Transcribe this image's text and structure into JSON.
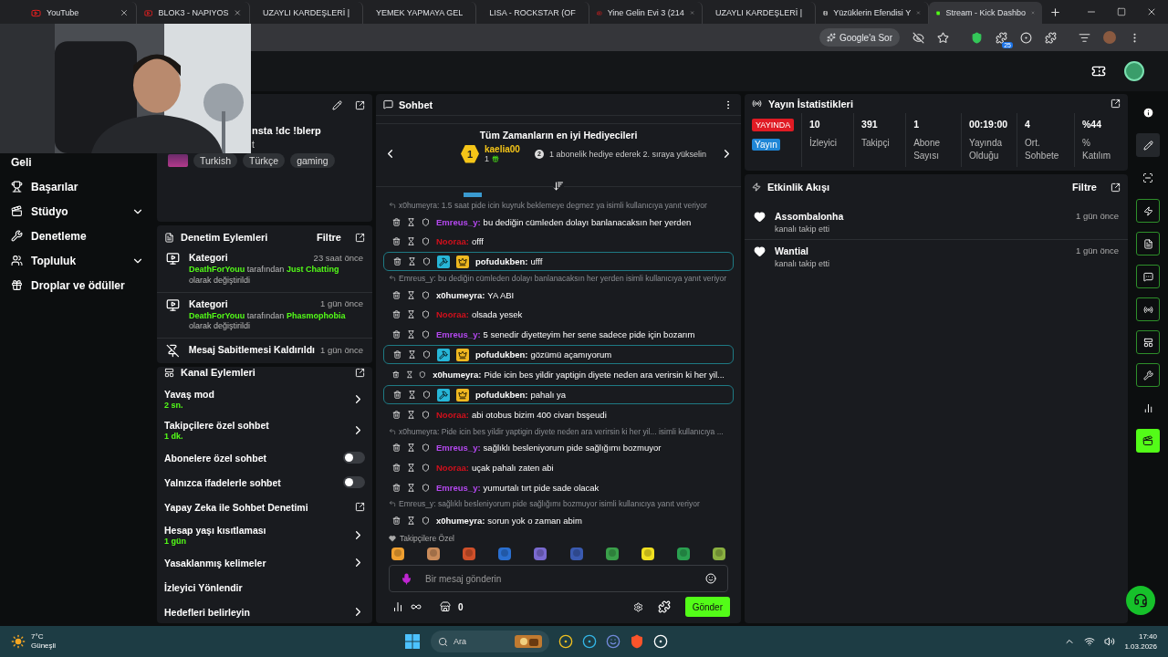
{
  "browser": {
    "tabs": [
      {
        "title": "YouTube",
        "selected": false
      },
      {
        "title": "BLOK3 - NAPIYOS",
        "selected": false
      },
      {
        "title": "UZAYLI KARDEŞLERİ |",
        "selected": false
      },
      {
        "title": "YEMEK YAPMAYA GEL",
        "selected": false
      },
      {
        "title": "LISA - ROCKSTAR (OF",
        "selected": false
      },
      {
        "title": "Yine Gelin Evi 3 (214",
        "selected": false
      },
      {
        "title": "UZAYLI KARDEŞLERİ |",
        "selected": false
      },
      {
        "title": "Yüzüklerin Efendisi Y",
        "selected": false
      },
      {
        "title": "Stream - Kick Dashbo",
        "selected": true
      }
    ],
    "ask_button": "Google'a Sor",
    "extension_badge": "25"
  },
  "sidebar": {
    "items": [
      {
        "label": "Geli",
        "expandable": false
      },
      {
        "label": "Başarılar",
        "expandable": false
      },
      {
        "label": "Stüdyo",
        "expandable": true
      },
      {
        "label": "Denetleme",
        "expandable": false
      },
      {
        "label": "Topluluk",
        "expandable": true
      },
      {
        "label": "Droplar ve ödüller",
        "expandable": false
      }
    ]
  },
  "stream_info": {
    "title": "nsta !dc !blerp",
    "subtitle": "t",
    "tags": [
      "Turkish",
      "Türkçe",
      "gaming"
    ]
  },
  "moderation": {
    "title": "Denetim Eylemleri",
    "filter": "Filtre",
    "items": [
      {
        "kind": "category",
        "title": "Kategori",
        "time": "23 saat önce",
        "detail": "**DeathForYouu** tarafından **Just Chatting** olarak değiştirildi"
      },
      {
        "kind": "category",
        "title": "Kategori",
        "time": "1 gün önce",
        "detail": "**DeathForYouu** tarafından **Phasmophobia** olarak değiştirildi"
      },
      {
        "kind": "unpin",
        "title": "Mesaj Sabitlemesi Kaldırıldı",
        "time": "1 gün önce"
      }
    ]
  },
  "channel_actions": {
    "title": "Kanal Eylemleri",
    "items": [
      {
        "kind": "chevron",
        "label": "Yavaş mod",
        "value": "2 sn."
      },
      {
        "kind": "chevron",
        "label": "Takipçilere özel sohbet",
        "value": "1 dk."
      },
      {
        "kind": "toggle",
        "label": "Abonelere özel sohbet",
        "on": false
      },
      {
        "kind": "toggle",
        "label": "Yalnızca ifadelerle sohbet",
        "on": false
      },
      {
        "kind": "link",
        "label": "Yapay Zeka ile Sohbet Denetimi"
      },
      {
        "kind": "chevron",
        "label": "Hesap yaşı kısıtlaması",
        "value": "1 gün"
      },
      {
        "kind": "chevron",
        "label": "Yasaklanmış kelimeler"
      },
      {
        "kind": "plain",
        "label": "İzleyici Yönlendir"
      },
      {
        "kind": "chevron",
        "label": "Hedefleri belirleyin"
      }
    ]
  },
  "chat": {
    "title": "Sohbet",
    "gifters": {
      "title": "Tüm Zamanların en iyi Hediyecileri",
      "rank": "1",
      "name": "kaelia00",
      "count": "1",
      "hint_rank": "2",
      "hint": "1 abonelik hediye ederek 2. sıraya yükselin"
    },
    "messages": [
      {
        "kind": "reply",
        "text": "x0humeyra: 1.5 saat pide icin kuyruk beklemeye degmez ya isimli kullanıcıya yanıt veriyor"
      },
      {
        "kind": "message",
        "user": "Emreus_y:",
        "color": "#b548f0",
        "text": "bu dediğin cümleden dolayı banlanacaksın her yerden"
      },
      {
        "kind": "message",
        "user": "Nooraa:",
        "color": "#d3101c",
        "text": "offf"
      },
      {
        "kind": "highlight",
        "user": "pofudukben:",
        "color": "#ffffff",
        "text": "ufff"
      },
      {
        "kind": "reply",
        "text": "Emreus_y: bu dediğin cümleden dolayı banlanacaksın her yerden isimli kullanıcıya yanıt veriyor"
      },
      {
        "kind": "message",
        "user": "x0humeyra:",
        "color": "#ffffff",
        "text": "YA ABI"
      },
      {
        "kind": "message",
        "user": "Nooraa:",
        "color": "#d3101c",
        "text": "olsada yesek"
      },
      {
        "kind": "message",
        "user": "Emreus_y:",
        "color": "#b548f0",
        "text": "5 senedir diyetteyim her sene sadece pide için bozarım"
      },
      {
        "kind": "highlight",
        "user": "pofudukben:",
        "color": "#ffffff",
        "text": "gözümü açamıyorum"
      },
      {
        "kind": "message",
        "user": "x0humeyra:",
        "color": "#ffffff",
        "text": "Pide icin bes yildir yaptigin diyete neden ara verirsin ki her yil..."
      },
      {
        "kind": "highlight",
        "user": "pofudukben:",
        "color": "#ffffff",
        "text": "pahalı ya"
      },
      {
        "kind": "message",
        "user": "Nooraa:",
        "color": "#d3101c",
        "text": "abi otobus bizim 400 civarı bsşeudi"
      },
      {
        "kind": "reply",
        "text": "x0humeyra: Pide icin bes yildir yaptigin diyete neden ara verirsin ki her yil... isimli kullanıcıya ..."
      },
      {
        "kind": "message",
        "user": "Emreus_y:",
        "color": "#b548f0",
        "text": "sağlıklı besleniyorum pide sağlığımı bozmuyor"
      },
      {
        "kind": "message",
        "user": "Nooraa:",
        "color": "#d3101c",
        "text": "uçak pahalı zaten abi"
      },
      {
        "kind": "message",
        "user": "Emreus_y:",
        "color": "#b548f0",
        "text": "yumurtalı tırt pide sade olacak"
      },
      {
        "kind": "reply",
        "text": "Emreus_y: sağlıklı besleniyorum pide sağlığımı bozmuyor isimli kullanıcıya yanıt veriyor"
      },
      {
        "kind": "message",
        "user": "x0humeyra:",
        "color": "#ffffff",
        "text": "sorun yok o zaman abim"
      }
    ],
    "emote_section": "Takipçilere Özel",
    "placeholder": "Bir mesaj gönderin",
    "points": "0",
    "send": "Gönder"
  },
  "stats": {
    "live_badge": "YAYINDA",
    "stream_button": "Yayın",
    "title": "Yayın İstatistikleri",
    "items": [
      {
        "value": "10",
        "label": "İzleyici"
      },
      {
        "value": "391",
        "label": "Takipçi"
      },
      {
        "value": "1",
        "label": "Abone Sayısı"
      },
      {
        "value": "00:19:00",
        "label": "Yayında Olduğu"
      },
      {
        "value": "4",
        "label": "Ort. Sohbete"
      },
      {
        "value": "%44",
        "label": "% Katılım"
      }
    ]
  },
  "activity": {
    "title": "Etkinlik Akışı",
    "filter": "Filtre",
    "items": [
      {
        "name": "Assombalonha",
        "action": "kanalı takip etti",
        "time": "1 gün önce"
      },
      {
        "name": "Wantial",
        "action": "kanalı takip etti",
        "time": "1 gün önce"
      }
    ]
  },
  "taskbar": {
    "temperature": "7°C",
    "weather": "Güneşli",
    "search": "Ara",
    "time": "17:40",
    "date": "1.03.2026"
  }
}
